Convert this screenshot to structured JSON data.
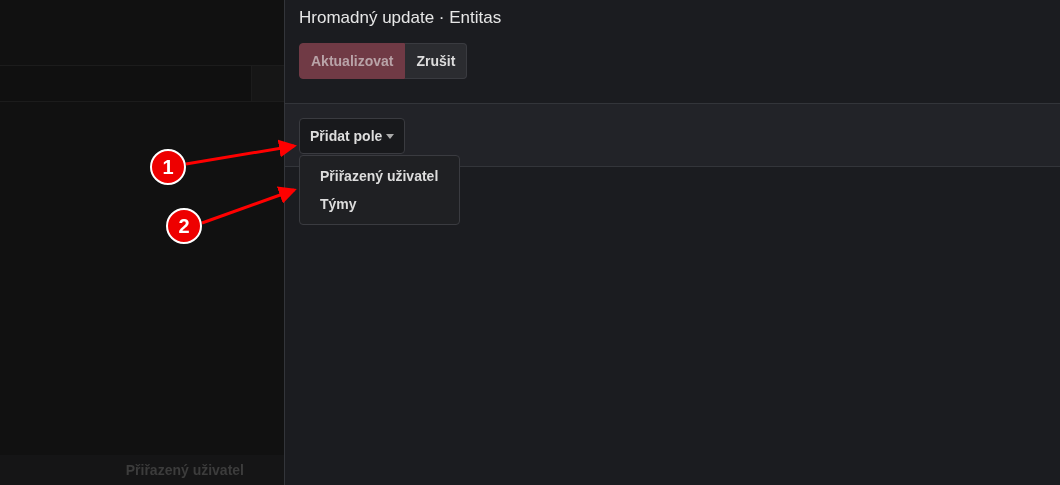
{
  "backdrop": {
    "footer_label": "Přiřazený uživatel"
  },
  "panel": {
    "title": "Hromadný update · Entitas",
    "buttons": [
      {
        "label": "Aktualizovat",
        "kind": "primary"
      },
      {
        "label": "Zrušit",
        "kind": "default"
      }
    ],
    "add_field": {
      "label": "Přidat pole",
      "expanded": true,
      "menu_items": [
        {
          "label": "Přiřazený uživatel"
        },
        {
          "label": "Týmy"
        }
      ]
    }
  },
  "annotations": [
    {
      "number": "1"
    },
    {
      "number": "2"
    }
  ]
}
